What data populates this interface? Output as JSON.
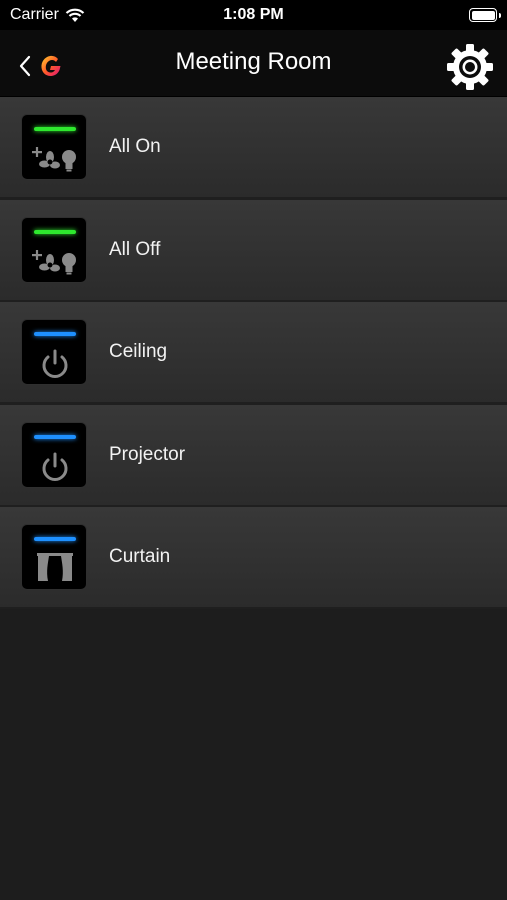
{
  "status_bar": {
    "carrier": "Carrier",
    "time": "1:08 PM"
  },
  "nav": {
    "title": "Meeting Room",
    "back_icon": "chevron-left-icon",
    "logo_icon": "g-logo-icon",
    "settings_icon": "gear-icon"
  },
  "colors": {
    "indicator_green": "#2ee82e",
    "indicator_blue": "#1e90ff",
    "background": "#1f1f1f"
  },
  "items": [
    {
      "label": "All On",
      "icon": "fan-bulb-icon",
      "indicator": "green"
    },
    {
      "label": "All Off",
      "icon": "fan-bulb-icon",
      "indicator": "green"
    },
    {
      "label": "Ceiling",
      "icon": "power-icon",
      "indicator": "blue"
    },
    {
      "label": "Projector",
      "icon": "power-icon",
      "indicator": "blue"
    },
    {
      "label": "Curtain",
      "icon": "curtain-icon",
      "indicator": "blue"
    }
  ]
}
